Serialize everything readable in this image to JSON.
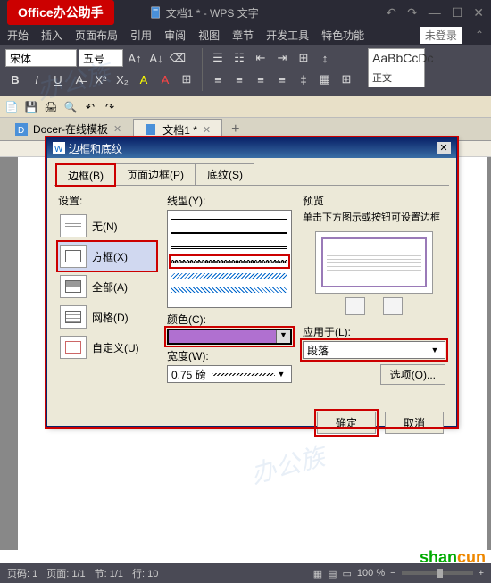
{
  "titlebar": {
    "office_badge": "Office办公助手",
    "doc_title": "文档1 * - WPS 文字"
  },
  "menubar": {
    "items": [
      "开始",
      "插入",
      "页面布局",
      "引用",
      "审阅",
      "视图",
      "章节",
      "开发工具",
      "特色功能"
    ],
    "login": "未登录"
  },
  "ribbon": {
    "font_name": "宋体",
    "font_size": "五号",
    "style_preview_text": "AaBbCcDc",
    "style_preview_label": "正文"
  },
  "doctabs": {
    "tab1": "Docer-在线模板",
    "tab2": "文档1 *"
  },
  "dialog": {
    "title": "边框和底纹",
    "tabs": {
      "border": "边框(B)",
      "page_border": "页面边框(P)",
      "shading": "底纹(S)"
    },
    "settings": {
      "label": "设置:",
      "none": "无(N)",
      "box": "方框(X)",
      "all": "全部(A)",
      "grid": "网格(D)",
      "custom": "自定义(U)"
    },
    "line": {
      "label": "线型(Y):",
      "color_label": "颜色(C):",
      "width_label": "宽度(W):",
      "width_value": "0.75 磅"
    },
    "preview": {
      "label": "预览",
      "desc": "单击下方图示或按钮可设置边框"
    },
    "apply": {
      "label": "应用于(L):",
      "value": "段落"
    },
    "options_btn": "选项(O)...",
    "ok": "确定",
    "cancel": "取消"
  },
  "statusbar": {
    "page": "页码: 1",
    "pages": "页面: 1/1",
    "section": "节: 1/1",
    "line": "行: 10",
    "zoom": "100 %"
  },
  "watermark": "办公族",
  "shancun_s": "shan",
  "shancun_c": "cun"
}
